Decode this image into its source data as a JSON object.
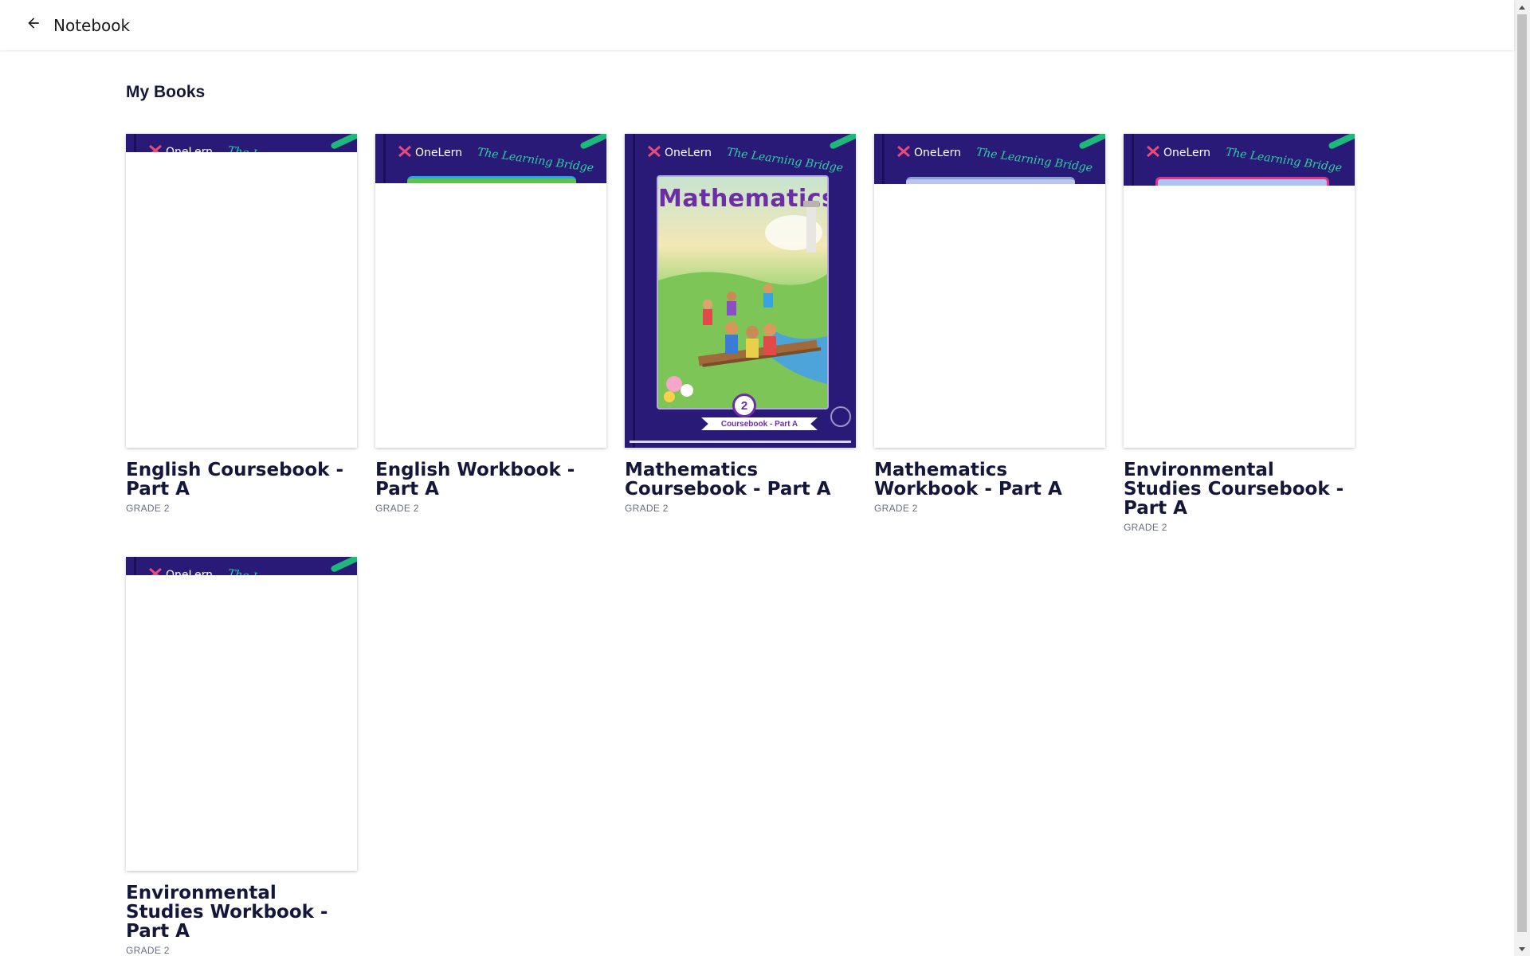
{
  "header": {
    "back_icon": "arrow-left-icon",
    "title": "Notebook"
  },
  "section": {
    "title": "My Books"
  },
  "brand": {
    "name": "OneLern",
    "tagline": "The Learning Bridge",
    "cover_color": "#2a1a78",
    "accent_color": "#2fd0a0"
  },
  "books": [
    {
      "title": "English Coursebook - Part A",
      "grade": "GRADE 2",
      "cover_loaded": false
    },
    {
      "title": "English Workbook - Part A",
      "grade": "GRADE 2",
      "cover_loaded": false
    },
    {
      "title": "Mathematics Coursebook - Part A",
      "grade": "GRADE 2",
      "cover_loaded": true,
      "cover_text": {
        "subject": "Mathematics",
        "grade_number": "2",
        "edition": "Coursebook - Part A"
      }
    },
    {
      "title": "Mathematics Workbook - Part A",
      "grade": "GRADE 2",
      "cover_loaded": false
    },
    {
      "title": "Environmental Studies Coursebook - Part A",
      "grade": "GRADE 2",
      "cover_loaded": false
    },
    {
      "title": "Environmental Studies Workbook - Part A",
      "grade": "GRADE 2",
      "cover_loaded": false
    }
  ]
}
